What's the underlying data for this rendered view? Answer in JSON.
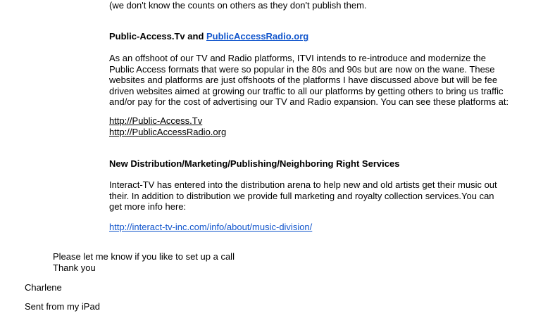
{
  "email": {
    "top_line": "(we don't know the counts on others as they don't publish them.",
    "section_public_access": {
      "heading_prefix": "Public-Access.Tv and ",
      "heading_link": "PublicAccessRadio.org",
      "paragraph_lines": [
        "As an offshoot of our TV and Radio platforms, ITVI intends to re-introduce and modernize the",
        "Public Access formats that were so popular in the 80s and 90s but are now on the wane. These",
        "websites and platforms are just offshoots of the platforms I have discussed above but will be fee",
        "driven websites aimed at growing our traffic to all our platforms by getting others to bring us traffic",
        "and/or pay for the cost of advertising our TV and Radio expansion. You can see these platforms at:"
      ],
      "links": [
        "http://Public-Access.Tv",
        "http://PublicAccessRadio.org"
      ]
    },
    "section_distribution": {
      "heading": "New Distribution/Marketing/Publishing/Neighboring Right Services",
      "paragraph_lines": [
        "Interact-TV has entered into the distribution arena to help new and old artists get their music out",
        "their. In addition to distribution we provide full marketing and royalty collection services.You can",
        "get more info here:"
      ],
      "link": "http://interact-tv-inc.com/info/about/music-division/"
    },
    "closing_lines": [
      "Please let me know if you like to set up a call",
      "Thank you"
    ],
    "signature": "Charlene",
    "footer": "Sent from my iPad"
  },
  "colors": {
    "link": "#1155cc",
    "text": "#000000",
    "background": "#ffffff"
  }
}
